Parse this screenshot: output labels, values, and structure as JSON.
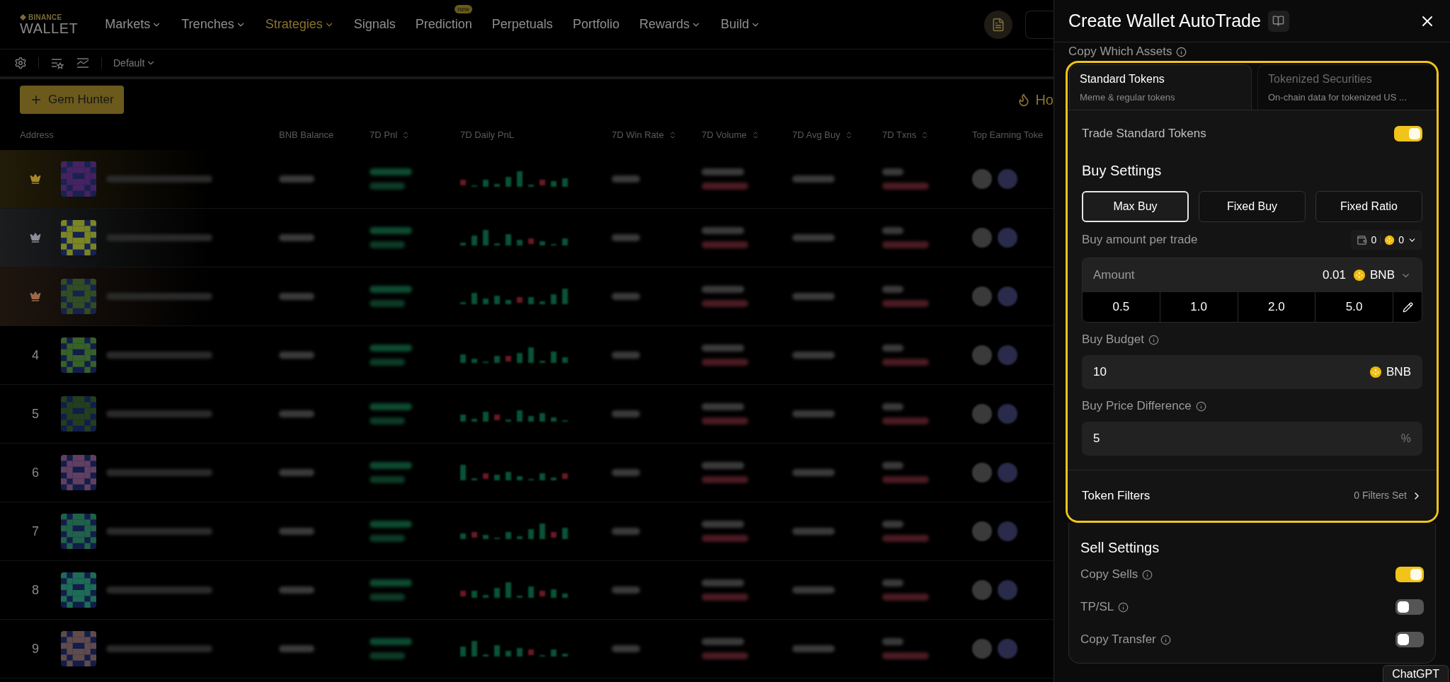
{
  "nav": {
    "logo_top": "BINANCE",
    "logo_bottom": "WALLET",
    "items": [
      {
        "label": "Markets",
        "dropdown": true,
        "selected": false
      },
      {
        "label": "Trenches",
        "dropdown": true,
        "selected": false
      },
      {
        "label": "Strategies",
        "dropdown": true,
        "selected": true
      },
      {
        "label": "Signals",
        "dropdown": false,
        "selected": false
      },
      {
        "label": "Prediction",
        "dropdown": false,
        "selected": false,
        "badge": "new"
      },
      {
        "label": "Perpetuals",
        "dropdown": false,
        "selected": false
      },
      {
        "label": "Portfolio",
        "dropdown": false,
        "selected": false
      },
      {
        "label": "Rewards",
        "dropdown": true,
        "selected": false
      },
      {
        "label": "Build",
        "dropdown": true,
        "selected": false
      }
    ]
  },
  "toolbar": {
    "preset": "Default"
  },
  "gem_hunter_button": "Gem Hunter",
  "hot_label": "Ho",
  "table": {
    "columns": [
      {
        "label": "Address",
        "sortable": false
      },
      {
        "label": "BNB Balance",
        "sortable": false
      },
      {
        "label": "7D Pnl",
        "sortable": true
      },
      {
        "label": "7D Daily PnL",
        "sortable": false
      },
      {
        "label": "7D Win Rate",
        "sortable": true
      },
      {
        "label": "7D Volume",
        "sortable": true
      },
      {
        "label": "7D Avg Buy",
        "sortable": true
      },
      {
        "label": "7D Txns",
        "sortable": true
      },
      {
        "label": "Top Earning Toke",
        "sortable": false
      }
    ],
    "rows": [
      {
        "kind": "crown",
        "color": "#a8862a"
      },
      {
        "kind": "crown",
        "color": "#8a8f99"
      },
      {
        "kind": "crown",
        "color": "#9a6a4a"
      },
      {
        "kind": "rank",
        "rank": "4"
      },
      {
        "kind": "rank",
        "rank": "5"
      },
      {
        "kind": "rank",
        "rank": "6"
      },
      {
        "kind": "rank",
        "rank": "7"
      },
      {
        "kind": "rank",
        "rank": "8"
      },
      {
        "kind": "rank",
        "rank": "9"
      }
    ]
  },
  "panel": {
    "title": "Create Wallet AutoTrade",
    "section_label": "Copy Which Assets",
    "tabs": [
      {
        "title": "Standard Tokens",
        "subtitle": "Meme & regular tokens",
        "selected": true
      },
      {
        "title": "Tokenized Securities",
        "subtitle": "On-chain data for tokenized US ...",
        "selected": false
      }
    ],
    "trade_toggle": {
      "label": "Trade Standard Tokens",
      "on": true
    },
    "buy_heading": "Buy Settings",
    "modes": [
      {
        "label": "Max Buy",
        "selected": true
      },
      {
        "label": "Fixed Buy",
        "selected": false
      },
      {
        "label": "Fixed Ratio",
        "selected": false
      }
    ],
    "per_trade_label": "Buy amount per trade",
    "wallet_count": "0",
    "coin_count": "0",
    "amount": {
      "label": "Amount",
      "value": "0.01",
      "unit": "BNB"
    },
    "presets": [
      "0.5",
      "1.0",
      "2.0",
      "5.0"
    ],
    "budget": {
      "label": "Buy Budget",
      "value": "10",
      "unit": "BNB"
    },
    "price_diff": {
      "label": "Buy Price Difference",
      "value": "5",
      "unit": "%"
    },
    "token_filters": {
      "label": "Token Filters",
      "value": "0 Filters Set"
    },
    "sell_heading": "Sell Settings",
    "sell_toggles": [
      {
        "label": "Copy Sells",
        "on": true
      },
      {
        "label": "TP/SL",
        "on": false
      },
      {
        "label": "Copy Transfer",
        "on": false
      }
    ]
  },
  "chat_tab": "ChatGPT"
}
